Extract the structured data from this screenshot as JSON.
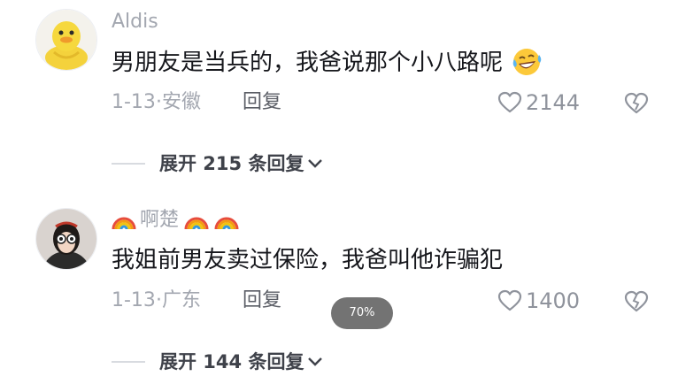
{
  "comments": [
    {
      "username": "Aldis",
      "text": "男朋友是当兵的，我爸说那个小八路呢",
      "emoji": "laughing-tears-icon",
      "date": "1-13",
      "separator": "·",
      "location": "安徽",
      "reply_label": "回复",
      "likes": "2144",
      "replies_label": "展开 215 条回复"
    },
    {
      "username": "啊楚",
      "decorations": [
        "rainbow-icon",
        "rainbow-icon",
        "rainbow-icon"
      ],
      "text": "我姐前男友卖过保险，我爸叫他诈骗犯",
      "date": "1-13",
      "separator": "·",
      "location": "广东",
      "reply_label": "回复",
      "likes": "1400",
      "replies_label": "展开 144 条回复"
    }
  ],
  "zoom_level": "70%",
  "colors": {
    "meta_gray": "#a3a7b0",
    "text_dark": "#16171c",
    "pill_bg": "#5a5a5a"
  }
}
